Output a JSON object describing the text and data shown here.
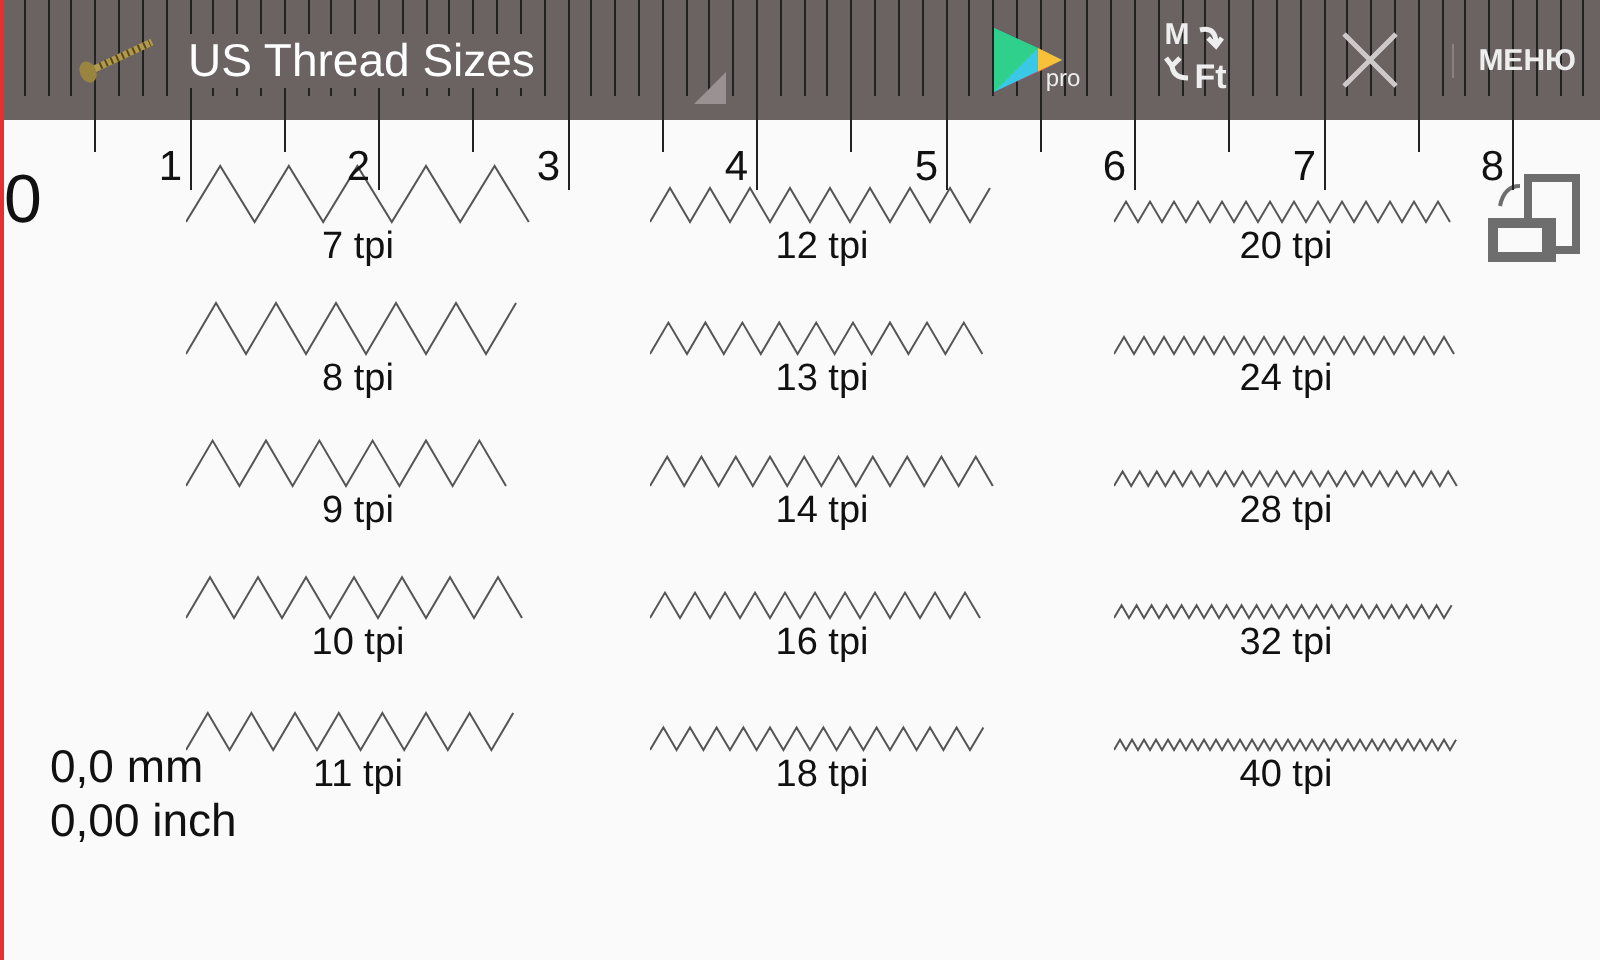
{
  "app_bar": {
    "title": "US Thread Sizes",
    "menu": "МЕНЮ",
    "pro_label": "pro",
    "unit_from": "M",
    "unit_to": "Ft"
  },
  "ruler": {
    "edge_reading": "0",
    "marks": [
      "1",
      "2",
      "3",
      "4",
      "5",
      "6",
      "7",
      "8"
    ]
  },
  "columns": [
    {
      "items": [
        "7 tpi",
        "8 tpi",
        "9 tpi",
        "10 tpi",
        "11 tpi"
      ]
    },
    {
      "items": [
        "12 tpi",
        "13 tpi",
        "14 tpi",
        "16 tpi",
        "18 tpi"
      ]
    },
    {
      "items": [
        "20 tpi",
        "24 tpi",
        "28 tpi",
        "32 tpi",
        "40 tpi"
      ]
    }
  ],
  "measurement": {
    "metric": "0,0 mm",
    "imperial": "0,00 inch"
  }
}
